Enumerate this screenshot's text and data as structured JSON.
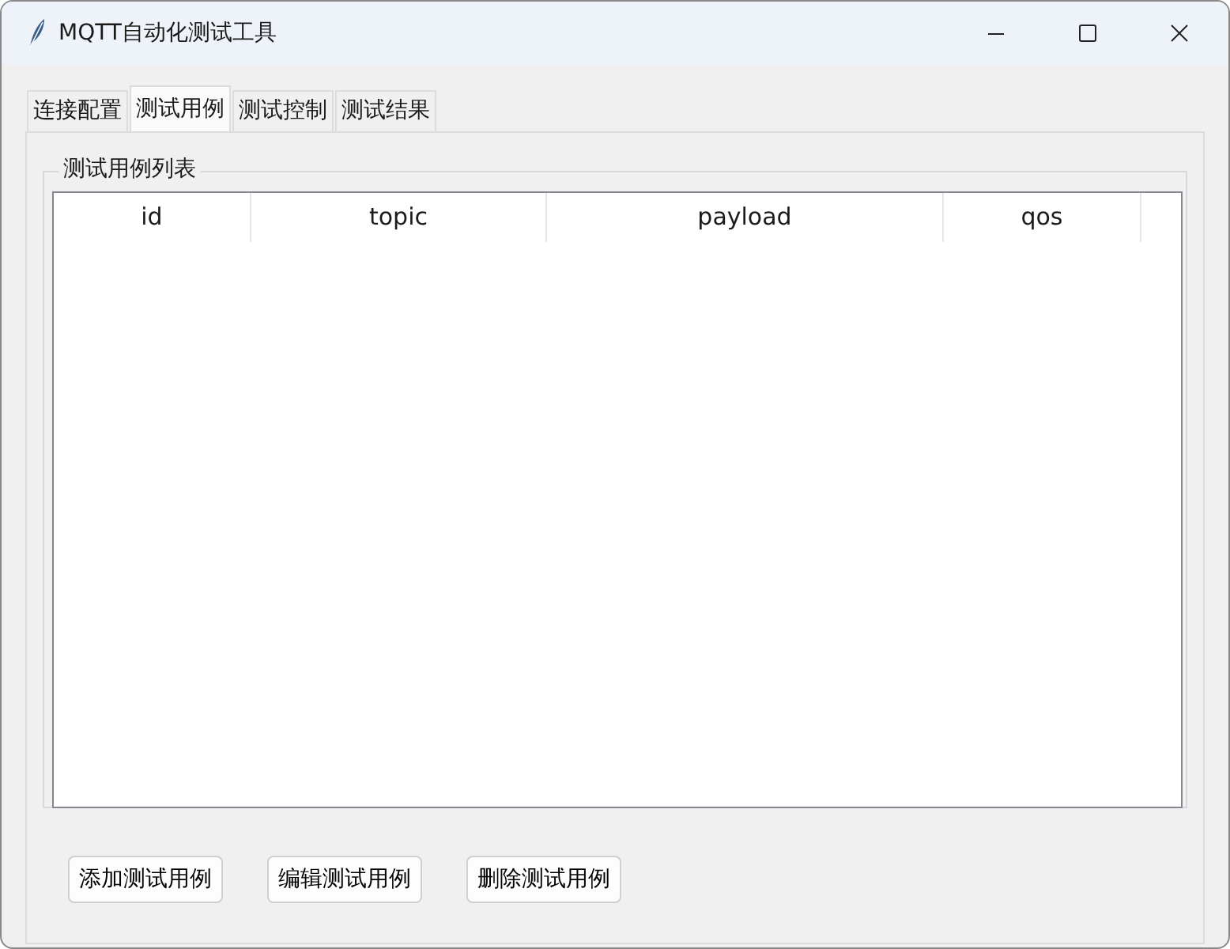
{
  "window": {
    "title": "MQTT自动化测试工具"
  },
  "tabs": [
    {
      "label": "连接配置",
      "selected": false
    },
    {
      "label": "测试用例",
      "selected": true
    },
    {
      "label": "测试控制",
      "selected": false
    },
    {
      "label": "测试结果",
      "selected": false
    }
  ],
  "group": {
    "title": "测试用例列表"
  },
  "table": {
    "columns": [
      "id",
      "topic",
      "payload",
      "qos"
    ]
  },
  "buttons": [
    "添加测试用例",
    "编辑测试用例",
    "删除测试用例"
  ]
}
